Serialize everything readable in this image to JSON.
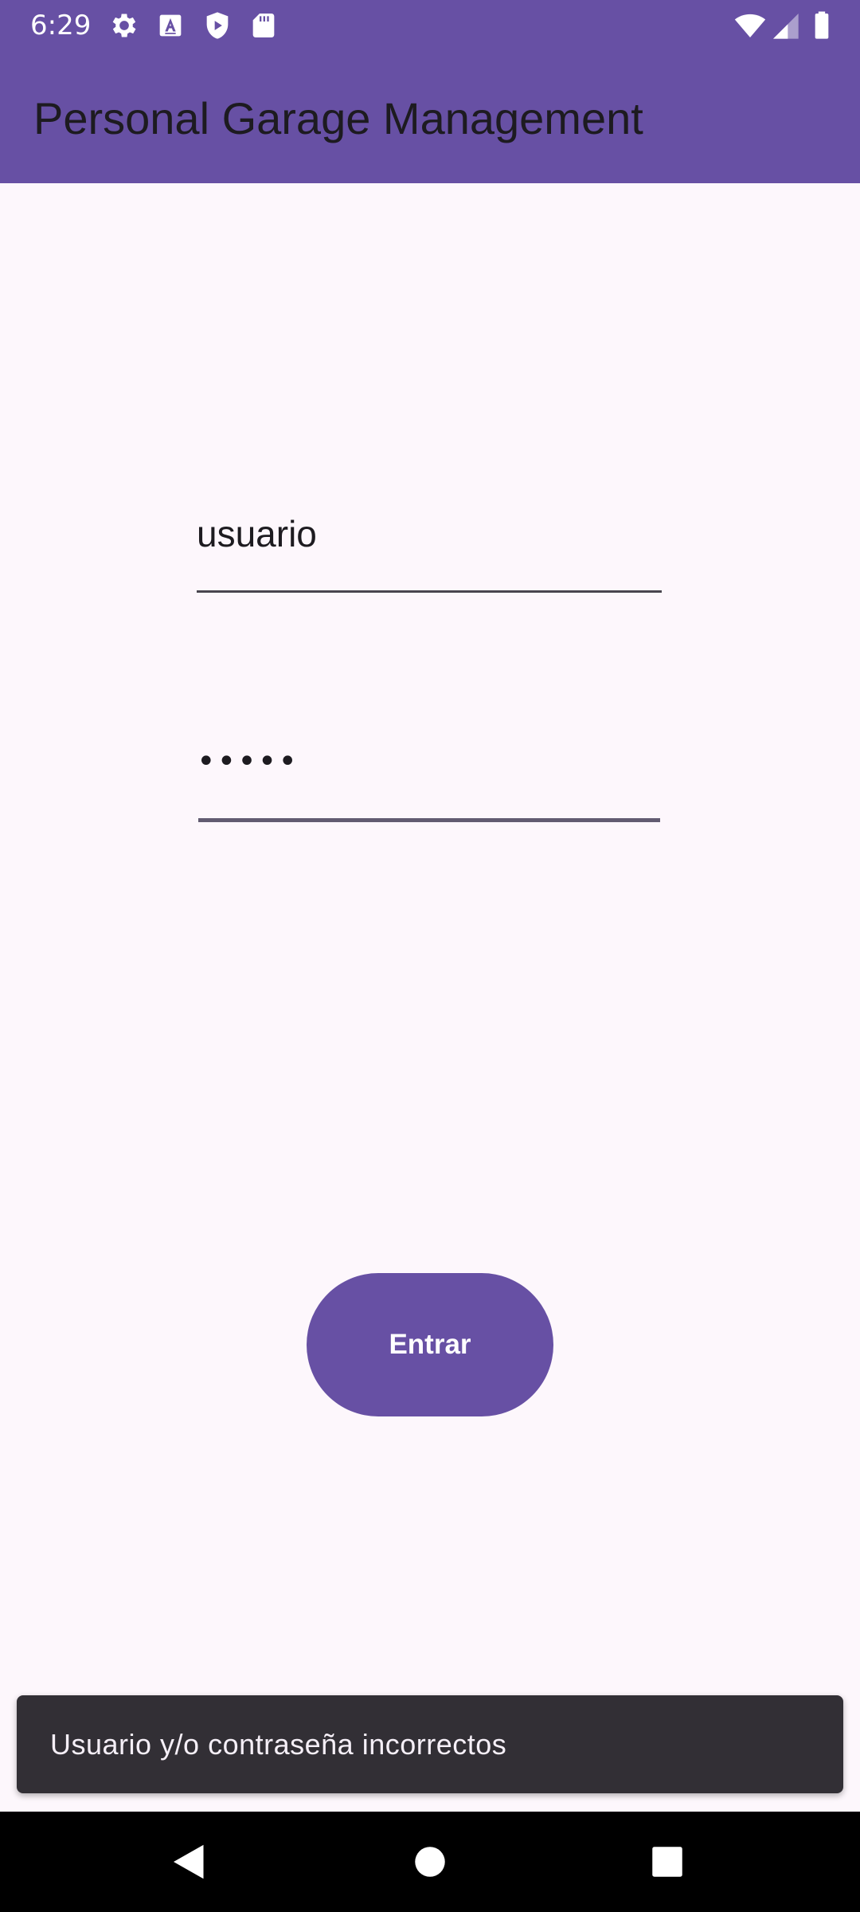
{
  "status_bar": {
    "time": "6:29",
    "left_icons": [
      "gear-icon",
      "font-a-icon",
      "shield-icon",
      "sd-card-icon"
    ],
    "right_icons": [
      "wifi-icon",
      "signal-icon",
      "battery-icon"
    ]
  },
  "app_bar": {
    "title": "Personal Garage Management"
  },
  "form": {
    "username_value": "usuario",
    "password_value": "•••••",
    "submit_label": "Entrar"
  },
  "snackbar": {
    "message": "Usuario y/o contraseña incorrectos"
  },
  "nav_bar": {
    "buttons": [
      "back-icon",
      "home-icon",
      "recents-icon"
    ]
  },
  "colors": {
    "primary": "#6750A4",
    "background": "#FDF7FC",
    "on_surface": "#1D1B20",
    "snackbar_bg": "#322F35",
    "snackbar_text": "#F5EFF7"
  }
}
